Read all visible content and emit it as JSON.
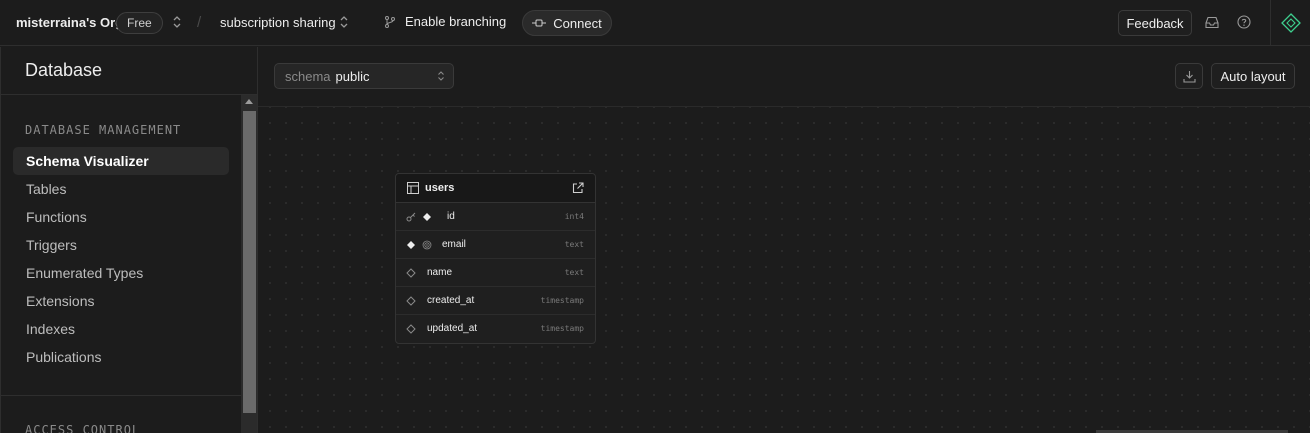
{
  "topbar": {
    "org_name": "misterraina's Org",
    "plan_badge": "Free",
    "project_name": "subscription sharing",
    "branching_label": "Enable branching",
    "connect_label": "Connect",
    "feedback_label": "Feedback"
  },
  "sidebar": {
    "title": "Database",
    "section_title": "DATABASE MANAGEMENT",
    "items": [
      {
        "label": "Schema Visualizer",
        "active": true
      },
      {
        "label": "Tables"
      },
      {
        "label": "Functions"
      },
      {
        "label": "Triggers"
      },
      {
        "label": "Enumerated Types"
      },
      {
        "label": "Extensions"
      },
      {
        "label": "Indexes"
      },
      {
        "label": "Publications"
      }
    ],
    "section2_title": "ACCESS CONTROL"
  },
  "toolbar": {
    "schema_prefix": "schema",
    "schema_value": "public",
    "auto_layout_label": "Auto layout"
  },
  "table": {
    "name": "users",
    "columns": [
      {
        "name": "id",
        "type": "int4",
        "primary_key": true
      },
      {
        "name": "email",
        "type": "text",
        "unique": true
      },
      {
        "name": "name",
        "type": "text"
      },
      {
        "name": "created_at",
        "type": "timestamp"
      },
      {
        "name": "updated_at",
        "type": "timestamp"
      }
    ]
  },
  "colors": {
    "background": "#1c1c1c",
    "border": "#2e2e2e",
    "brand_accent": "#3ecf8e"
  }
}
